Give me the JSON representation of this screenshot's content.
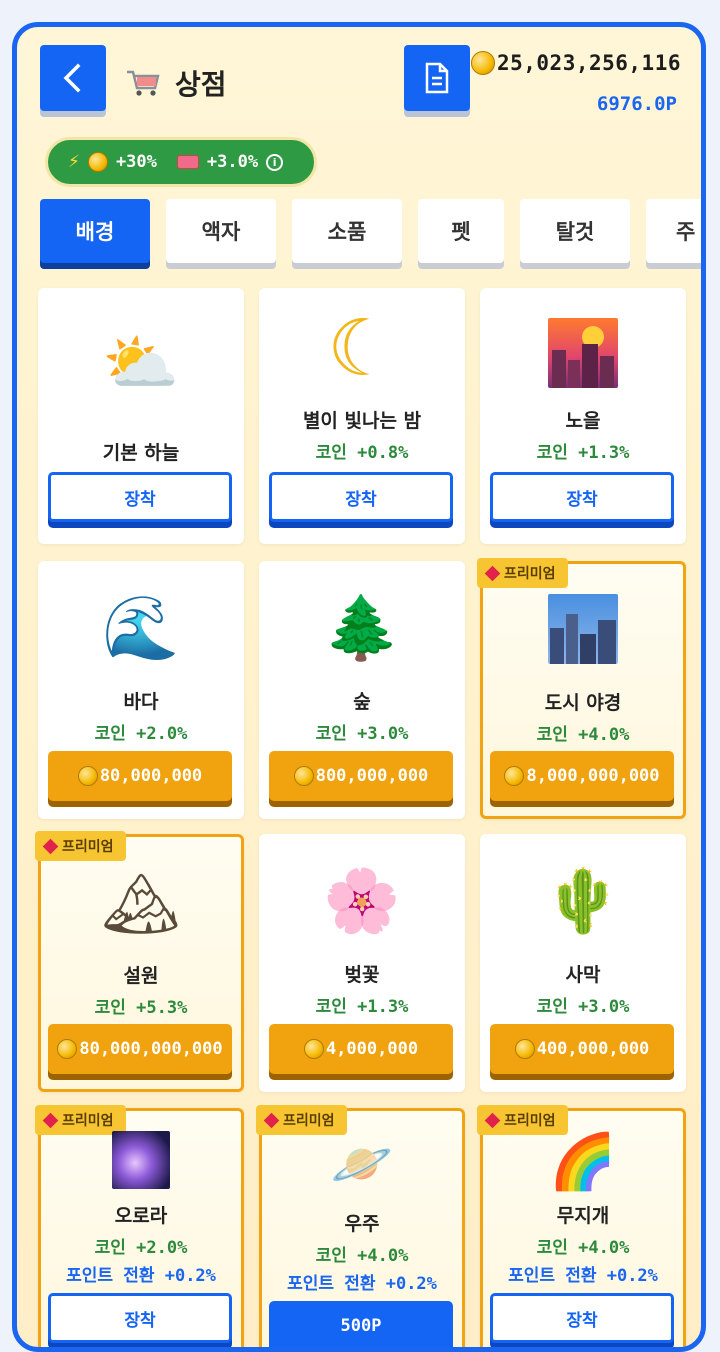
{
  "header": {
    "title": "상점",
    "coins": "25,023,256,116",
    "points": "6976.0P"
  },
  "boost": {
    "coin_boost": "+30%",
    "ticket_boost": "+3.0%"
  },
  "tabs": [
    {
      "label": "배경",
      "active": true
    },
    {
      "label": "액자"
    },
    {
      "label": "소품"
    },
    {
      "label": "펫"
    },
    {
      "label": "탈것"
    },
    {
      "label": "주"
    }
  ],
  "items": [
    {
      "name": "기본 하늘",
      "icon": "sun-behind-cloud",
      "glyph": "⛅",
      "button": "장착",
      "button_type": "equip"
    },
    {
      "name": "별이 빛나는 밤",
      "icon": "crescent-moon",
      "glyph": "☾",
      "bonus": "코인 +0.8%",
      "button": "장착",
      "button_type": "equip"
    },
    {
      "name": "노을",
      "icon": "sunset-city",
      "glyph": "",
      "bonus": "코인 +1.3%",
      "button": "장착",
      "button_type": "equip"
    },
    {
      "name": "바다",
      "icon": "water-wave",
      "glyph": "🌊",
      "bonus": "코인 +2.0%",
      "button": "80,000,000",
      "button_type": "price"
    },
    {
      "name": "숲",
      "icon": "evergreen-tree",
      "glyph": "🌲",
      "bonus": "코인 +3.0%",
      "button": "800,000,000",
      "button_type": "price"
    },
    {
      "name": "도시 야경",
      "icon": "cityscape",
      "glyph": "",
      "bonus": "코인 +4.0%",
      "button": "8,000,000,000",
      "button_type": "price",
      "premium": "프리미엄"
    },
    {
      "name": "설원",
      "icon": "snow-mountain",
      "glyph": "🏔",
      "bonus": "코인 +5.3%",
      "button": "80,000,000,000",
      "button_type": "price",
      "premium": "프리미엄"
    },
    {
      "name": "벚꽃",
      "icon": "cherry-blossom",
      "glyph": "🌸",
      "bonus": "코인 +1.3%",
      "button": "4,000,000",
      "button_type": "price"
    },
    {
      "name": "사막",
      "icon": "desert-cactus",
      "glyph": "🌵",
      "bonus": "코인 +3.0%",
      "button": "400,000,000",
      "button_type": "price"
    },
    {
      "name": "오로라",
      "icon": "milky-way",
      "glyph": "",
      "bonus": "코인 +2.0%",
      "bonus2": "포인트 전환 +0.2%",
      "button": "장착",
      "button_type": "equip",
      "premium": "프리미엄"
    },
    {
      "name": "우주",
      "icon": "ringed-planet",
      "glyph": "🪐",
      "bonus": "코인 +4.0%",
      "bonus2": "포인트 전환 +0.2%",
      "button": "500P",
      "button_type": "points",
      "premium": "프리미엄"
    },
    {
      "name": "무지개",
      "icon": "rainbow",
      "glyph": "🌈",
      "bonus": "코인 +4.0%",
      "bonus2": "포인트 전환 +0.2%",
      "button": "장착",
      "button_type": "equip",
      "premium": "프리미엄"
    }
  ],
  "colors": {
    "primary": "#1565f5",
    "price": "#f0a30f",
    "bonus_green": "#2d8a3c",
    "premium_border": "#f0a413"
  }
}
